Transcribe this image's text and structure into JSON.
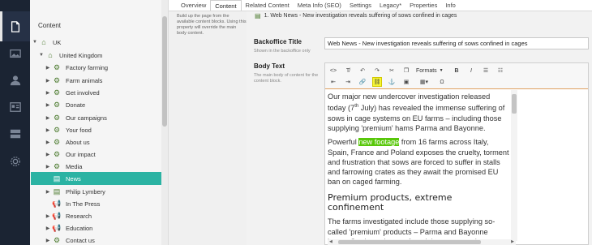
{
  "rail": {
    "items": [
      {
        "name": "content",
        "icon": "document-icon",
        "active": true
      },
      {
        "name": "media",
        "icon": "image-icon",
        "active": false
      },
      {
        "name": "members",
        "icon": "user-icon",
        "active": false
      },
      {
        "name": "forms",
        "icon": "form-icon",
        "active": false
      },
      {
        "name": "settings",
        "icon": "server-icon",
        "active": false
      },
      {
        "name": "developer",
        "icon": "gear-icon",
        "active": false
      }
    ]
  },
  "tree": {
    "heading": "Content",
    "nodes": [
      {
        "label": "UK",
        "icon": "home-icon"
      },
      {
        "label": "United Kingdom",
        "icon": "home-icon"
      },
      {
        "label": "Factory farming",
        "icon": "gear-icon"
      },
      {
        "label": "Farm animals",
        "icon": "gear-icon"
      },
      {
        "label": "Get involved",
        "icon": "gear-icon"
      },
      {
        "label": "Donate",
        "icon": "gear-icon"
      },
      {
        "label": "Our campaigns",
        "icon": "gear-icon"
      },
      {
        "label": "Your food",
        "icon": "gear-icon"
      },
      {
        "label": "About us",
        "icon": "gear-icon"
      },
      {
        "label": "Our impact",
        "icon": "gear-icon"
      },
      {
        "label": "Media",
        "icon": "gear-icon"
      },
      {
        "label": "News",
        "icon": "list-icon",
        "selected": true
      },
      {
        "label": "Philip Lymbery",
        "icon": "list-icon"
      },
      {
        "label": "In The Press",
        "icon": "megaphone-icon"
      },
      {
        "label": "Research",
        "icon": "megaphone-icon"
      },
      {
        "label": "Education",
        "icon": "megaphone-icon"
      },
      {
        "label": "Contact us",
        "icon": "gear-icon"
      }
    ]
  },
  "tabs": [
    "Overview",
    "Content",
    "Related Content",
    "Meta Info (SEO)",
    "Settings",
    "Legacy*",
    "Properties",
    "Info"
  ],
  "active_tab": "Content",
  "left_description": "Build up the page from the available content blocks. Using this property will override the main body content.",
  "breadcrumb": "1. Web News - New investigation reveals suffering of sows confined in cages",
  "backoffice_title": {
    "label": "Backoffice Title",
    "description": "Shown in the backoffice only",
    "value": "Web News - New investigation reveals suffering of sows confined in cages"
  },
  "body_text": {
    "label": "Body Text",
    "description": "The main body of content for the content block."
  },
  "toolbar": {
    "formats_label": "Formats"
  },
  "content": {
    "p1_a": "Our major new undercover investigation released today (7",
    "p1_sup": "th",
    "p1_b": " July) has revealed the immense suffering of sows in cage systems on EU farms – including those supplying 'premium' hams Parma and Bayonne.",
    "p2_a": "Powerful ",
    "p2_highlight": "new footage",
    "p2_b": " from 16 farms across Italy, Spain, France and Poland exposes the cruelty, torment and frustration that sows are forced to suffer in stalls and farrowing crates as they await the promised EU ban on caged farming.",
    "heading": "Premium products, extreme confinement",
    "p3": "The farms investigated include those supplying so-called 'premium' products – Parma and Bayonne hams. Our investigators found that sows on these"
  },
  "colors": {
    "rail_bg": "#1b2433",
    "selected_bg": "#2bb3a3",
    "highlight_text_bg": "#58c70a",
    "highlight_button_bg": "#f5f533"
  }
}
